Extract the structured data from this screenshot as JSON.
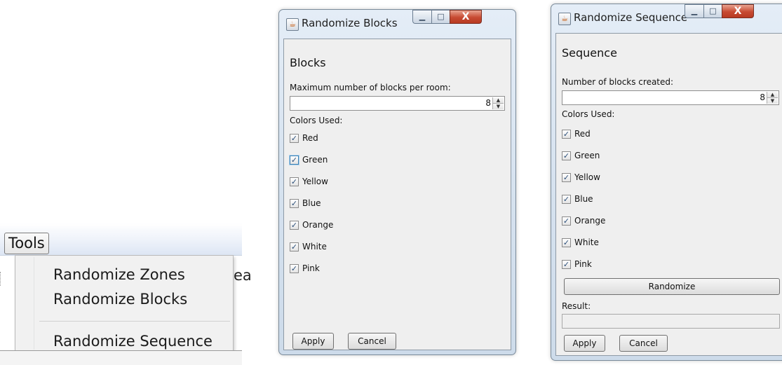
{
  "menu": {
    "title": "Tools",
    "items": [
      "Randomize Zones",
      "Randomize Blocks",
      "Randomize Sequence"
    ],
    "bg_fragment": "ea"
  },
  "blocks_dialog": {
    "title": "Randomize Blocks",
    "heading": "Blocks",
    "max_label": "Maximum number of blocks per room:",
    "max_value": "8",
    "colors_label": "Colors Used:",
    "colors": [
      "Red",
      "Green",
      "Yellow",
      "Blue",
      "Orange",
      "White",
      "Pink"
    ],
    "apply": "Apply",
    "cancel": "Cancel"
  },
  "sequence_dialog": {
    "title": "Randomize Sequence",
    "heading": "Sequence",
    "count_label": "Number of blocks created:",
    "count_value": "8",
    "colors_label": "Colors Used:",
    "colors": [
      "Red",
      "Green",
      "Yellow",
      "Blue",
      "Orange",
      "White",
      "Pink"
    ],
    "randomize": "Randomize",
    "result_label": "Result:",
    "result_value": "",
    "apply": "Apply",
    "cancel": "Cancel"
  },
  "icons": {
    "check": "✓",
    "minimize": "▁",
    "maximize": "□",
    "close": "X",
    "java": "☕",
    "spin_up": "▲",
    "spin_down": "▼"
  }
}
